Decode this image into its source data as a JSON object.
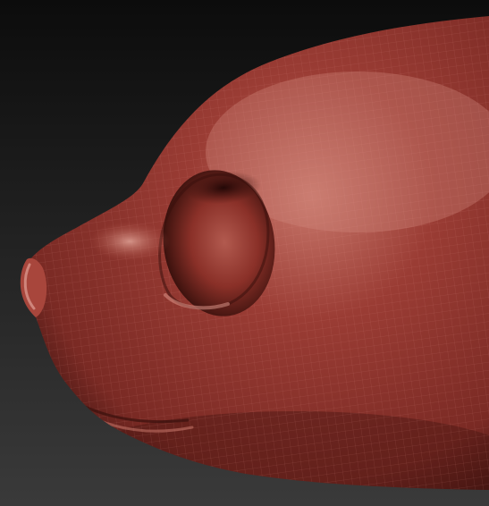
{
  "scene": {
    "subject_icon": "sculpt-head-icon",
    "colors": {
      "background_top": "#0c0c0c",
      "background_bottom": "#3a3a3a",
      "clay_base": "#9a3c34",
      "clay_highlight": "#c46a5e",
      "clay_shadow": "#3a120f",
      "wireframe": "#b0584c"
    }
  }
}
